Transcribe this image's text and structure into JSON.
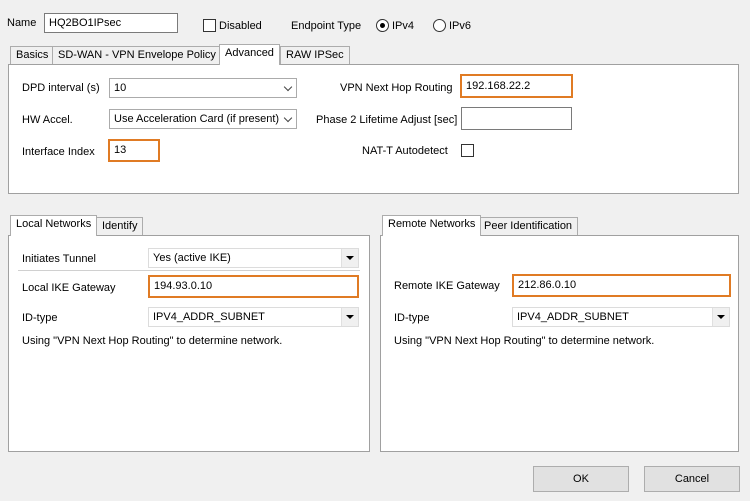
{
  "header": {
    "name_label": "Name",
    "name_value": "HQ2BO1IPsec",
    "disabled_label": "Disabled",
    "endpoint_type_label": "Endpoint Type",
    "ipv4_label": "IPv4",
    "ipv6_label": "IPv6"
  },
  "tabs": [
    {
      "label": "Basics"
    },
    {
      "label": "SD-WAN - VPN Envelope Policy"
    },
    {
      "label": "Advanced"
    },
    {
      "label": "RAW IPSec"
    }
  ],
  "advanced": {
    "dpd_label": "DPD interval (s)",
    "dpd_value": "10",
    "hw_accel_label": "HW Accel.",
    "hw_accel_value": "Use Acceleration Card (if present)",
    "interface_index_label": "Interface Index",
    "interface_index_value": "13",
    "vpn_next_hop_label": "VPN Next Hop Routing",
    "vpn_next_hop_value": "192.168.22.2",
    "phase2_label": "Phase 2 Lifetime Adjust [sec]",
    "phase2_value": "",
    "natt_label": "NAT-T Autodetect"
  },
  "local": {
    "tabs": [
      {
        "label": "Local Networks"
      },
      {
        "label": "Identify"
      }
    ],
    "initiates_label": "Initiates Tunnel",
    "initiates_value": "Yes (active IKE)",
    "gateway_label": "Local IKE Gateway",
    "gateway_value": "194.93.0.10",
    "idtype_label": "ID-type",
    "idtype_value": "IPV4_ADDR_SUBNET",
    "note": "Using \"VPN Next Hop Routing\" to determine network."
  },
  "remote": {
    "tabs": [
      {
        "label": "Remote Networks"
      },
      {
        "label": "Peer Identification"
      }
    ],
    "gateway_label": "Remote IKE Gateway",
    "gateway_value": "212.86.0.10",
    "idtype_label": "ID-type",
    "idtype_value": "IPV4_ADDR_SUBNET",
    "note": "Using \"VPN Next Hop Routing\" to determine network."
  },
  "buttons": {
    "ok": "OK",
    "cancel": "Cancel"
  },
  "colors": {
    "highlight": "#e07b24",
    "background": "#f0f0f0"
  }
}
